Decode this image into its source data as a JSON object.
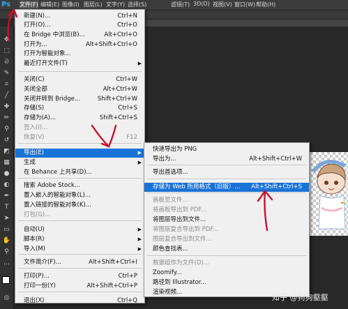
{
  "app": {
    "logo": "Ps"
  },
  "menubar": [
    "文件(F)",
    "编辑(E)",
    "图像(I)",
    "图层(L)",
    "文字(Y)",
    "选择(S)",
    "滤镜(T)",
    "3D(D)",
    "视图(V)",
    "窗口(W)",
    "帮助(H)"
  ],
  "file_menu": [
    {
      "label": "新建(N)...",
      "shortcut": "Ctrl+N"
    },
    {
      "label": "打开(O)...",
      "shortcut": "Ctrl+O"
    },
    {
      "label": "在 Bridge 中浏览(B)...",
      "shortcut": "Alt+Ctrl+O"
    },
    {
      "label": "打开为...",
      "shortcut": "Alt+Shift+Ctrl+O"
    },
    {
      "label": "打开为智能对象...",
      "shortcut": ""
    },
    {
      "label": "最近打开文件(T)",
      "shortcut": ""
    },
    {
      "label": "关闭(C)",
      "shortcut": "Ctrl+W"
    },
    {
      "label": "关闭全部",
      "shortcut": "Alt+Ctrl+W"
    },
    {
      "label": "关闭并转到 Bridge...",
      "shortcut": "Shift+Ctrl+W"
    },
    {
      "label": "存储(S)",
      "shortcut": "Ctrl+S"
    },
    {
      "label": "存储为(A)...",
      "shortcut": "Shift+Ctrl+S"
    },
    {
      "label": "签入(I)...",
      "shortcut": ""
    },
    {
      "label": "恢复(V)",
      "shortcut": "F12"
    },
    {
      "label": "导出(E)",
      "shortcut": ""
    },
    {
      "label": "生成",
      "shortcut": ""
    },
    {
      "label": "在 Behance 上共享(D)...",
      "shortcut": ""
    },
    {
      "label": "搜索 Adobe Stock...",
      "shortcut": ""
    },
    {
      "label": "置入嵌入的智能对象(L)...",
      "shortcut": ""
    },
    {
      "label": "置入链接的智能对象(K)...",
      "shortcut": ""
    },
    {
      "label": "打包(G)...",
      "shortcut": ""
    },
    {
      "label": "自动(U)",
      "shortcut": ""
    },
    {
      "label": "脚本(R)",
      "shortcut": ""
    },
    {
      "label": "导入(M)",
      "shortcut": ""
    },
    {
      "label": "文件简介(F)...",
      "shortcut": "Alt+Shift+Ctrl+I"
    },
    {
      "label": "打印(P)...",
      "shortcut": "Ctrl+P"
    },
    {
      "label": "打印一份(Y)",
      "shortcut": "Alt+Shift+Ctrl+P"
    },
    {
      "label": "退出(X)",
      "shortcut": "Ctrl+Q"
    }
  ],
  "export_menu": [
    {
      "label": "快速导出为 PNG",
      "shortcut": ""
    },
    {
      "label": "导出为...",
      "shortcut": "Alt+Shift+Ctrl+W"
    },
    {
      "label": "导出首选项...",
      "shortcut": ""
    },
    {
      "label": "存储为 Web 所用格式（旧版）...",
      "shortcut": "Alt+Shift+Ctrl+S"
    },
    {
      "label": "画板至文件...",
      "shortcut": ""
    },
    {
      "label": "将画板导出到 PDF...",
      "shortcut": ""
    },
    {
      "label": "将图层导出到文件...",
      "shortcut": ""
    },
    {
      "label": "将图层复合导出到 PDF...",
      "shortcut": ""
    },
    {
      "label": "图层复合导出到文件...",
      "shortcut": ""
    },
    {
      "label": "颜色查找表...",
      "shortcut": ""
    },
    {
      "label": "数据组作为文件(D)...",
      "shortcut": ""
    },
    {
      "label": "Zoomify...",
      "shortcut": ""
    },
    {
      "label": "路径到 Illustrator...",
      "shortcut": ""
    },
    {
      "label": "渲染视频...",
      "shortcut": ""
    }
  ],
  "watermark": "知乎 @狗狗壑壑",
  "colors": {
    "highlight": "#1a73d6",
    "annotation": "#c8102e",
    "menu_bg": "#f0f0f0"
  }
}
